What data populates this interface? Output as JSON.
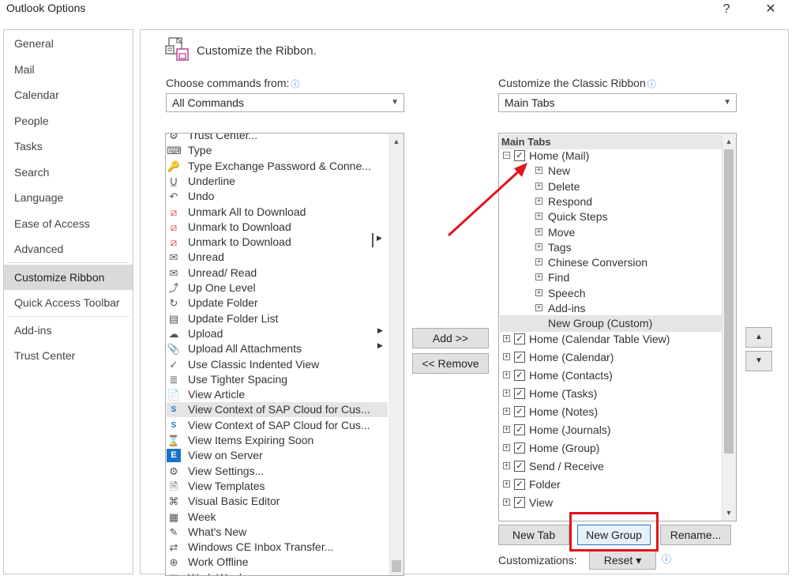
{
  "window": {
    "title": "Outlook Options",
    "help_glyph": "?",
    "close_glyph": "✕"
  },
  "nav": {
    "items": [
      {
        "label": "General"
      },
      {
        "label": "Mail"
      },
      {
        "label": "Calendar"
      },
      {
        "label": "People"
      },
      {
        "label": "Tasks"
      },
      {
        "label": "Search"
      },
      {
        "label": "Language"
      },
      {
        "label": "Ease of Access"
      },
      {
        "label": "Advanced"
      },
      {
        "label": "Customize Ribbon"
      },
      {
        "label": "Quick Access Toolbar"
      },
      {
        "label": "Add-ins"
      },
      {
        "label": "Trust Center"
      }
    ],
    "selected": "Customize Ribbon"
  },
  "page": {
    "heading": "Customize the Ribbon.",
    "heading_icon": "customize-ribbon-icon"
  },
  "left": {
    "choose_label": "Choose commands from:",
    "choose_value": "All Commands",
    "commands": [
      {
        "label": "Trust Center...",
        "icon": "trust-center-icon"
      },
      {
        "label": "Type",
        "icon": "type-icon"
      },
      {
        "label": "Type Exchange Password & Conne...",
        "icon": "key-icon"
      },
      {
        "label": "Underline",
        "icon": "underline-icon"
      },
      {
        "label": "Undo",
        "icon": "undo-icon"
      },
      {
        "label": "Unmark All to Download",
        "icon": "unmark-icon"
      },
      {
        "label": "Unmark to Download",
        "icon": "unmark-icon"
      },
      {
        "label": "Unmark to Download",
        "icon": "unmark-icon"
      },
      {
        "label": "Unread",
        "icon": "envelope-icon"
      },
      {
        "label": "Unread/ Read",
        "icon": "envelope-icon"
      },
      {
        "label": "Up One Level",
        "icon": "up-level-icon"
      },
      {
        "label": "Update Folder",
        "icon": "update-folder-icon"
      },
      {
        "label": "Update Folder List",
        "icon": "folder-list-icon"
      },
      {
        "label": "Upload",
        "icon": "cloud-upload-icon"
      },
      {
        "label": "Upload All Attachments",
        "icon": "attachments-icon"
      },
      {
        "label": "Use Classic Indented View",
        "icon": "checkmark-icon"
      },
      {
        "label": "Use Tighter Spacing",
        "icon": "spacing-icon"
      },
      {
        "label": "View Article",
        "icon": "article-icon"
      },
      {
        "label": "View Context of SAP Cloud for Cus...",
        "icon": "sap-icon"
      },
      {
        "label": "View Context of SAP Cloud for Cus...",
        "icon": "sap-icon"
      },
      {
        "label": "View Items Expiring Soon",
        "icon": "expiring-icon"
      },
      {
        "label": "View on Server",
        "icon": "exchange-icon"
      },
      {
        "label": "View Settings...",
        "icon": "settings-icon"
      },
      {
        "label": "View Templates",
        "icon": "templates-icon"
      },
      {
        "label": "Visual Basic Editor",
        "icon": "vba-icon"
      },
      {
        "label": "Week",
        "icon": "week-icon"
      },
      {
        "label": "What's New",
        "icon": "whats-new-icon"
      },
      {
        "label": "Windows CE Inbox Transfer...",
        "icon": "transfer-icon"
      },
      {
        "label": "Work Offline",
        "icon": "globe-icon"
      },
      {
        "label": "Work Week",
        "icon": "week-icon"
      }
    ]
  },
  "middle": {
    "add_label": "Add >>",
    "remove_label": "<< Remove"
  },
  "right": {
    "customize_label": "Customize the Classic Ribbon",
    "customize_value": "Main Tabs",
    "tree_header": "Main Tabs",
    "tree": [
      {
        "label": "Home (Mail)",
        "level": 0,
        "expander": "⊟",
        "checked": true
      },
      {
        "label": "New",
        "level": 1,
        "expander": "⊞"
      },
      {
        "label": "Delete",
        "level": 1,
        "expander": "⊞"
      },
      {
        "label": "Respond",
        "level": 1,
        "expander": "⊞"
      },
      {
        "label": "Quick Steps",
        "level": 1,
        "expander": "⊞"
      },
      {
        "label": "Move",
        "level": 1,
        "expander": "⊞"
      },
      {
        "label": "Tags",
        "level": 1,
        "expander": "⊞"
      },
      {
        "label": "Chinese Conversion",
        "level": 1,
        "expander": "⊞"
      },
      {
        "label": "Find",
        "level": 1,
        "expander": "⊞"
      },
      {
        "label": "Speech",
        "level": 1,
        "expander": "⊞"
      },
      {
        "label": "Add-ins",
        "level": 1,
        "expander": "⊞"
      },
      {
        "label": "New Group (Custom)",
        "level": 1,
        "expander": "",
        "selected": true
      },
      {
        "label": "Home (Calendar Table View)",
        "level": 0,
        "expander": "⊞",
        "checked": true
      },
      {
        "label": "Home (Calendar)",
        "level": 0,
        "expander": "⊞",
        "checked": true
      },
      {
        "label": "Home (Contacts)",
        "level": 0,
        "expander": "⊞",
        "checked": true
      },
      {
        "label": "Home (Tasks)",
        "level": 0,
        "expander": "⊞",
        "checked": true
      },
      {
        "label": "Home (Notes)",
        "level": 0,
        "expander": "⊞",
        "checked": true
      },
      {
        "label": "Home (Journals)",
        "level": 0,
        "expander": "⊞",
        "checked": true
      },
      {
        "label": "Home (Group)",
        "level": 0,
        "expander": "⊞",
        "checked": true
      },
      {
        "label": "Send / Receive",
        "level": 0,
        "expander": "⊞",
        "checked": true
      },
      {
        "label": "Folder",
        "level": 0,
        "expander": "⊞",
        "checked": true
      },
      {
        "label": "View",
        "level": 0,
        "expander": "⊞",
        "checked": true
      }
    ],
    "new_tab_label": "New Tab",
    "new_group_label": "New Group",
    "rename_label": "Rename...",
    "customizations_label": "Customizations:",
    "reset_label": "Reset ▾",
    "up_glyph": "▲",
    "down_glyph": "▼"
  },
  "annotation": {
    "highlight_color": "#e0141e",
    "arrow_color": "#e0141e"
  }
}
